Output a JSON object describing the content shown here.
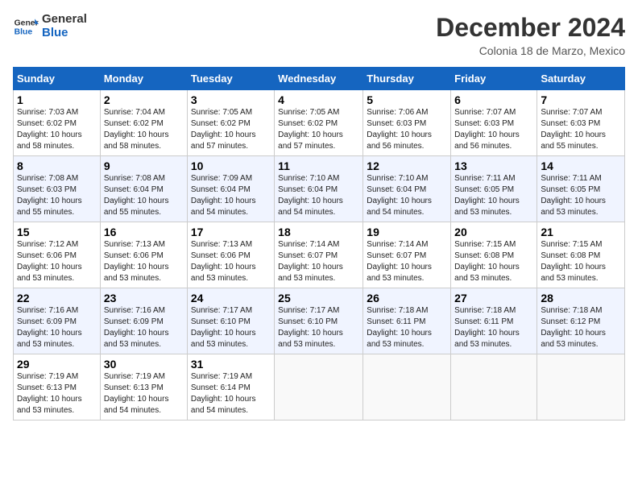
{
  "logo": {
    "line1": "General",
    "line2": "Blue"
  },
  "title": "December 2024",
  "subtitle": "Colonia 18 de Marzo, Mexico",
  "days_of_week": [
    "Sunday",
    "Monday",
    "Tuesday",
    "Wednesday",
    "Thursday",
    "Friday",
    "Saturday"
  ],
  "weeks": [
    [
      {
        "day": "1",
        "info": "Sunrise: 7:03 AM\nSunset: 6:02 PM\nDaylight: 10 hours\nand 58 minutes."
      },
      {
        "day": "2",
        "info": "Sunrise: 7:04 AM\nSunset: 6:02 PM\nDaylight: 10 hours\nand 58 minutes."
      },
      {
        "day": "3",
        "info": "Sunrise: 7:05 AM\nSunset: 6:02 PM\nDaylight: 10 hours\nand 57 minutes."
      },
      {
        "day": "4",
        "info": "Sunrise: 7:05 AM\nSunset: 6:02 PM\nDaylight: 10 hours\nand 57 minutes."
      },
      {
        "day": "5",
        "info": "Sunrise: 7:06 AM\nSunset: 6:03 PM\nDaylight: 10 hours\nand 56 minutes."
      },
      {
        "day": "6",
        "info": "Sunrise: 7:07 AM\nSunset: 6:03 PM\nDaylight: 10 hours\nand 56 minutes."
      },
      {
        "day": "7",
        "info": "Sunrise: 7:07 AM\nSunset: 6:03 PM\nDaylight: 10 hours\nand 55 minutes."
      }
    ],
    [
      {
        "day": "8",
        "info": "Sunrise: 7:08 AM\nSunset: 6:03 PM\nDaylight: 10 hours\nand 55 minutes."
      },
      {
        "day": "9",
        "info": "Sunrise: 7:08 AM\nSunset: 6:04 PM\nDaylight: 10 hours\nand 55 minutes."
      },
      {
        "day": "10",
        "info": "Sunrise: 7:09 AM\nSunset: 6:04 PM\nDaylight: 10 hours\nand 54 minutes."
      },
      {
        "day": "11",
        "info": "Sunrise: 7:10 AM\nSunset: 6:04 PM\nDaylight: 10 hours\nand 54 minutes."
      },
      {
        "day": "12",
        "info": "Sunrise: 7:10 AM\nSunset: 6:04 PM\nDaylight: 10 hours\nand 54 minutes."
      },
      {
        "day": "13",
        "info": "Sunrise: 7:11 AM\nSunset: 6:05 PM\nDaylight: 10 hours\nand 53 minutes."
      },
      {
        "day": "14",
        "info": "Sunrise: 7:11 AM\nSunset: 6:05 PM\nDaylight: 10 hours\nand 53 minutes."
      }
    ],
    [
      {
        "day": "15",
        "info": "Sunrise: 7:12 AM\nSunset: 6:06 PM\nDaylight: 10 hours\nand 53 minutes."
      },
      {
        "day": "16",
        "info": "Sunrise: 7:13 AM\nSunset: 6:06 PM\nDaylight: 10 hours\nand 53 minutes."
      },
      {
        "day": "17",
        "info": "Sunrise: 7:13 AM\nSunset: 6:06 PM\nDaylight: 10 hours\nand 53 minutes."
      },
      {
        "day": "18",
        "info": "Sunrise: 7:14 AM\nSunset: 6:07 PM\nDaylight: 10 hours\nand 53 minutes."
      },
      {
        "day": "19",
        "info": "Sunrise: 7:14 AM\nSunset: 6:07 PM\nDaylight: 10 hours\nand 53 minutes."
      },
      {
        "day": "20",
        "info": "Sunrise: 7:15 AM\nSunset: 6:08 PM\nDaylight: 10 hours\nand 53 minutes."
      },
      {
        "day": "21",
        "info": "Sunrise: 7:15 AM\nSunset: 6:08 PM\nDaylight: 10 hours\nand 53 minutes."
      }
    ],
    [
      {
        "day": "22",
        "info": "Sunrise: 7:16 AM\nSunset: 6:09 PM\nDaylight: 10 hours\nand 53 minutes."
      },
      {
        "day": "23",
        "info": "Sunrise: 7:16 AM\nSunset: 6:09 PM\nDaylight: 10 hours\nand 53 minutes."
      },
      {
        "day": "24",
        "info": "Sunrise: 7:17 AM\nSunset: 6:10 PM\nDaylight: 10 hours\nand 53 minutes."
      },
      {
        "day": "25",
        "info": "Sunrise: 7:17 AM\nSunset: 6:10 PM\nDaylight: 10 hours\nand 53 minutes."
      },
      {
        "day": "26",
        "info": "Sunrise: 7:18 AM\nSunset: 6:11 PM\nDaylight: 10 hours\nand 53 minutes."
      },
      {
        "day": "27",
        "info": "Sunrise: 7:18 AM\nSunset: 6:11 PM\nDaylight: 10 hours\nand 53 minutes."
      },
      {
        "day": "28",
        "info": "Sunrise: 7:18 AM\nSunset: 6:12 PM\nDaylight: 10 hours\nand 53 minutes."
      }
    ],
    [
      {
        "day": "29",
        "info": "Sunrise: 7:19 AM\nSunset: 6:13 PM\nDaylight: 10 hours\nand 53 minutes."
      },
      {
        "day": "30",
        "info": "Sunrise: 7:19 AM\nSunset: 6:13 PM\nDaylight: 10 hours\nand 54 minutes."
      },
      {
        "day": "31",
        "info": "Sunrise: 7:19 AM\nSunset: 6:14 PM\nDaylight: 10 hours\nand 54 minutes."
      },
      {
        "day": "",
        "info": ""
      },
      {
        "day": "",
        "info": ""
      },
      {
        "day": "",
        "info": ""
      },
      {
        "day": "",
        "info": ""
      }
    ]
  ]
}
